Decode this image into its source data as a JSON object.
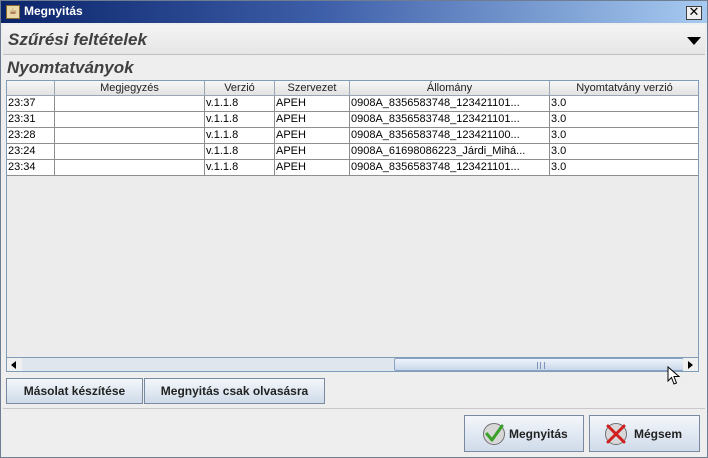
{
  "window": {
    "title": "Megnyitás",
    "icon": "java-cup-icon",
    "close_label": "✕"
  },
  "filter_panel": {
    "title": "Szűrési feltételek",
    "toggle_icon": "chevron-down-icon"
  },
  "section": {
    "title": "Nyomtatványok"
  },
  "table": {
    "columns": [
      "",
      "Megjegyzés",
      "Verzió",
      "Szervezet",
      "Állomány",
      "Nyomtatvány verzió"
    ],
    "rows": [
      [
        "23:37",
        "",
        "v.1.1.8",
        "APEH",
        "0908A_8356583748_123421101...",
        "3.0"
      ],
      [
        "23:31",
        "",
        "v.1.1.8",
        "APEH",
        "0908A_8356583748_123421101...",
        "3.0"
      ],
      [
        "23:28",
        "",
        "v.1.1.8",
        "APEH",
        "0908A_8356583748_123421100...",
        "3.0"
      ],
      [
        "23:24",
        "",
        "v.1.1.8",
        "APEH",
        "0908A_61698086223_Járdi_Mihá...",
        "3.0"
      ],
      [
        "23:34",
        "",
        "v.1.1.8",
        "APEH",
        "0908A_8356583748_123421101...",
        "3.0"
      ]
    ]
  },
  "buttons": {
    "copy": "Másolat készítése",
    "open_readonly": "Megnyitás csak olvasásra",
    "open": "Megnyitás",
    "cancel": "Mégsem"
  },
  "icons": {
    "open": "check-icon",
    "cancel": "cross-icon",
    "cursor": "mouse-pointer-icon"
  },
  "colors": {
    "title_bar": "#0a246a",
    "row_bg": "#ffffff",
    "accent_check": "#3aa02a",
    "accent_cross": "#d02020"
  }
}
